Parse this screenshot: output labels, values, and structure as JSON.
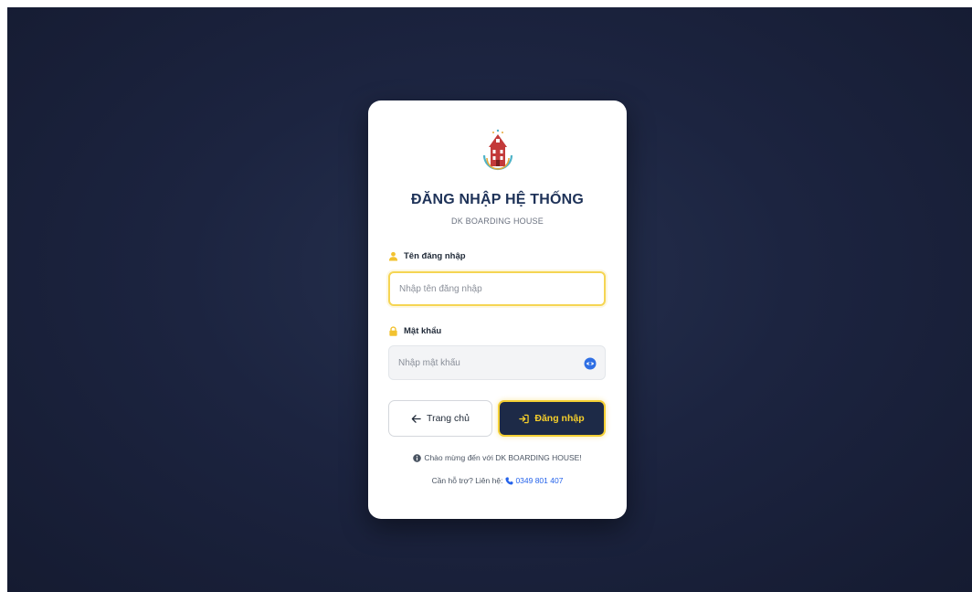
{
  "login": {
    "title": "ĐĂNG NHẬP HỆ THỐNG",
    "subtitle": "DK BOARDING HOUSE",
    "username": {
      "label": "Tên đăng nhập",
      "placeholder": "Nhập tên đăng nhập",
      "value": ""
    },
    "password": {
      "label": "Mật khẩu",
      "placeholder": "Nhập mật khẩu",
      "value": ""
    },
    "buttons": {
      "home_label": "Trang chủ",
      "login_label": "Đăng nhập"
    },
    "welcome_text": "Chào mừng đến với DK BOARDING HOUSE!",
    "support_text": "Cần hỗ trợ? Liên hệ:",
    "support_phone": "0349 801 407"
  },
  "icons": {
    "logo": "boarding-house-logo",
    "username_label": "user-icon",
    "password_label": "lock-icon",
    "password_toggle": "eye-icon",
    "home_button": "arrow-left-icon",
    "login_button": "sign-in-icon",
    "welcome": "info-circle-icon",
    "support": "phone-icon"
  },
  "colors": {
    "background": "#1c2440",
    "card": "#ffffff",
    "title": "#1e3258",
    "accent_yellow": "#f4cf34",
    "login_button_bg": "#1d2a47",
    "link_blue": "#2563eb"
  }
}
